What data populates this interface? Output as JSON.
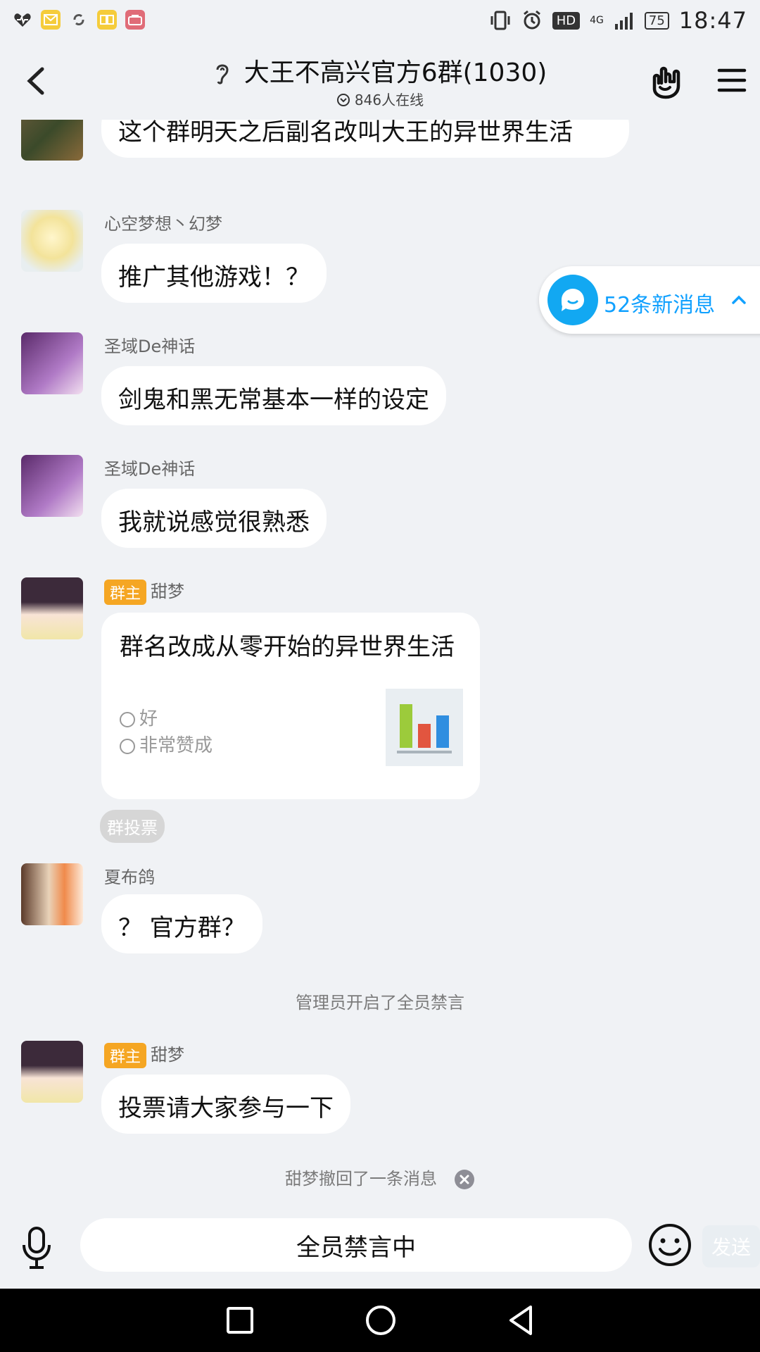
{
  "status_bar": {
    "battery": "75",
    "time": "18:47",
    "network": "4G",
    "hd": "HD"
  },
  "header": {
    "title": "大王不高兴官方6群(1030)",
    "online": "846人在线"
  },
  "new_messages": "52条新消息",
  "messages": [
    {
      "nick": "",
      "text": "这个群明天之后副名改叫大王的异世界生活"
    },
    {
      "nick": "心空梦想丶幻梦",
      "text": "推广其他游戏！？"
    },
    {
      "nick": "圣域De神话",
      "text": "剑鬼和黑无常基本一样的设定"
    },
    {
      "nick": "圣域De神话",
      "text": "我就说感觉很熟悉"
    },
    {
      "badge": "群主",
      "nick": "甜梦"
    },
    {
      "nick": "夏布鸽",
      "text": "？ 官方群？"
    },
    {
      "badge": "群主",
      "nick": "甜梦",
      "text": "投票请大家参与一下"
    }
  ],
  "poll": {
    "question": "群名改成从零开始的异世界生活",
    "options": [
      "好",
      "非常赞成"
    ],
    "tag": "群投票"
  },
  "system": {
    "ban_notice": "管理员开启了全员禁言",
    "recall_notice": "甜梦撤回了一条消息"
  },
  "input": {
    "placeholder": "全员禁言中",
    "send_label": "发送"
  },
  "colors": {
    "background": "#f0f2f5",
    "accent": "#11a1ff",
    "owner_badge": "#f5a623"
  }
}
